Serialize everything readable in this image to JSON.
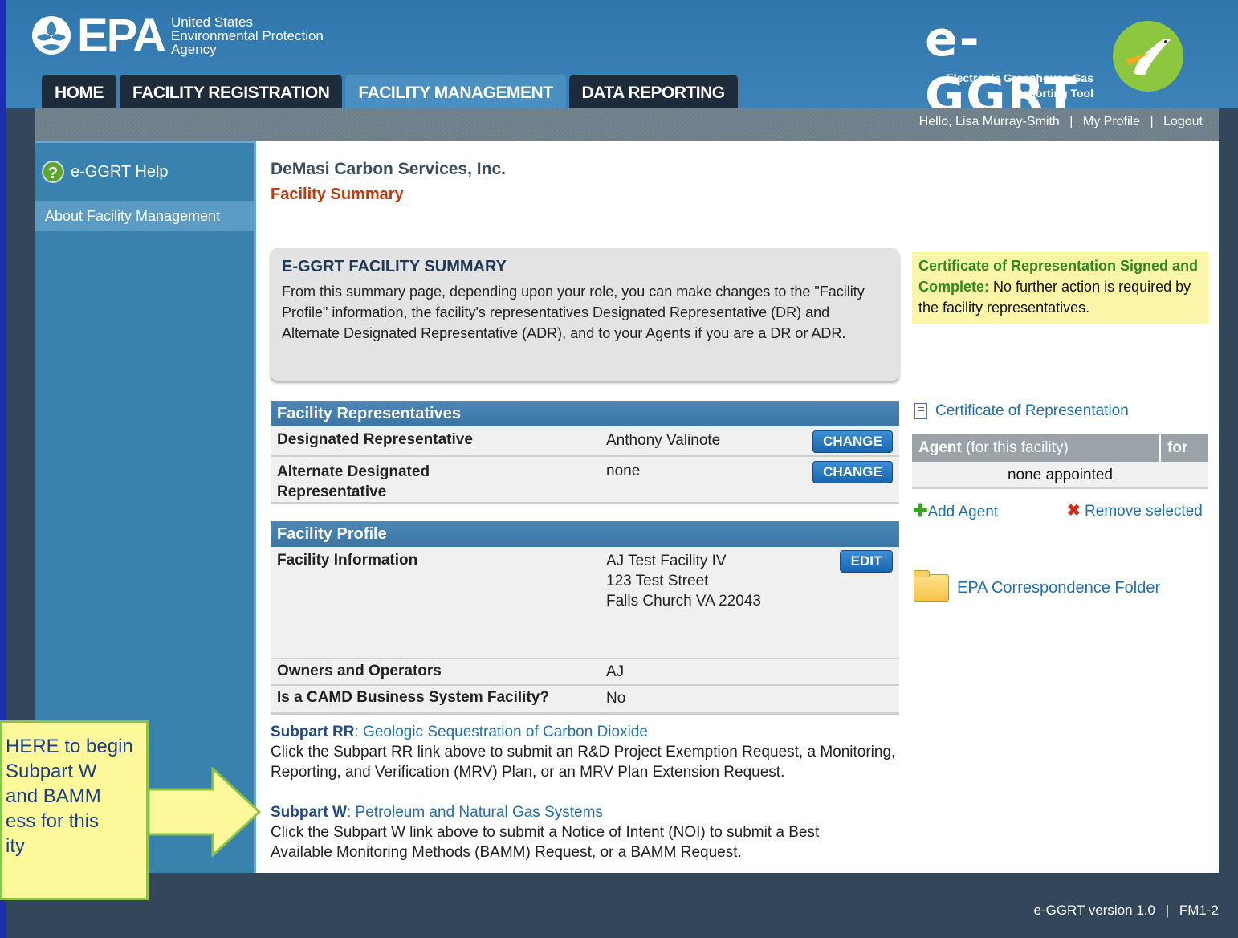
{
  "header": {
    "agency_line1": "United States",
    "agency_line2": "Environmental Protection",
    "agency_line3": "Agency",
    "epa_logo_text": "EPA",
    "app_logo_text": "e-GGRT",
    "app_subtitle_line1": "Electronic Greenhouse Gas",
    "app_subtitle_line2": "Reporting Tool"
  },
  "tabs": [
    {
      "label": "HOME"
    },
    {
      "label": "FACILITY REGISTRATION"
    },
    {
      "label": "FACILITY MANAGEMENT"
    },
    {
      "label": "DATA REPORTING"
    }
  ],
  "userbar": {
    "greeting": "Hello, Lisa Murray-Smith",
    "my_profile": "My Profile",
    "logout": "Logout",
    "separator": "|"
  },
  "sidebar": {
    "help_label": "e-GGRT Help",
    "about_label": "About Facility Management"
  },
  "page": {
    "company": "DeMasi Carbon Services, Inc.",
    "title": "Facility Summary"
  },
  "summary_box": {
    "heading": "E-GGRT FACILITY SUMMARY",
    "body": "From this summary page, depending upon your role, you can make changes to the \"Facility Profile\" information, the facility's representatives Designated Representative (DR) and Alternate Designated Representative (ADR), and to your Agents if you are a DR or ADR."
  },
  "cert_note": {
    "bold": "Certificate of Representation Signed and Complete:",
    "text": " No further action is required by the facility representatives."
  },
  "representatives": {
    "heading": "Facility Representatives",
    "rows": [
      {
        "label": "Designated Representative",
        "value": "Anthony Valinote",
        "button": "CHANGE"
      },
      {
        "label": "Alternate Designated Representative",
        "value": "none",
        "button": "CHANGE"
      }
    ]
  },
  "profile": {
    "heading": "Facility Profile",
    "facility_label": "Facility Information",
    "facility_name": "AJ Test Facility IV",
    "facility_street": "123 Test Street",
    "facility_city": "Falls Church VA 22043",
    "edit_button": "EDIT",
    "owners_label": "Owners and Operators",
    "owners_value": "AJ",
    "camd_label": "Is a CAMD Business System Facility?",
    "camd_value": "No"
  },
  "right_panel": {
    "cert_link": "Certificate of Representation",
    "agent_header_bold": "Agent",
    "agent_header_rest": " (for this facility)",
    "agent_header_col2": "for",
    "agent_empty": "none appointed",
    "add_agent": "Add Agent",
    "remove_selected": "Remove selected",
    "folder_link": "EPA Correspondence Folder"
  },
  "subparts": [
    {
      "code": "Subpart RR",
      "title": ": Geologic Sequestration of Carbon Dioxide",
      "desc": "Click the Subpart RR link above to submit an R&D Project Exemption Request, a Monitoring, Reporting, and Verification (MRV) Plan, or an MRV Plan Extension Request."
    },
    {
      "code": "Subpart W",
      "title": ": Petroleum and Natural Gas Systems",
      "desc": "Click the Subpart W link above to submit a Notice of Intent (NOI) to submit a Best Available Monitoring Methods (BAMM) Request, or a BAMM Request."
    }
  ],
  "callout": {
    "line1": "HERE to begin",
    "line2": "Subpart W",
    "line3": "and BAMM",
    "line4": "ess for this",
    "line5": "ity"
  },
  "footer": {
    "version": "e-GGRT version 1.0",
    "sep": "|",
    "code": "FM1-2"
  },
  "colors": {
    "header_blue": "#3c83b8",
    "tab_dark": "#1d2b3a",
    "page_title_red": "#c0390d",
    "link_blue": "#1f6fb3",
    "note_yellow": "#fbf6a7"
  }
}
